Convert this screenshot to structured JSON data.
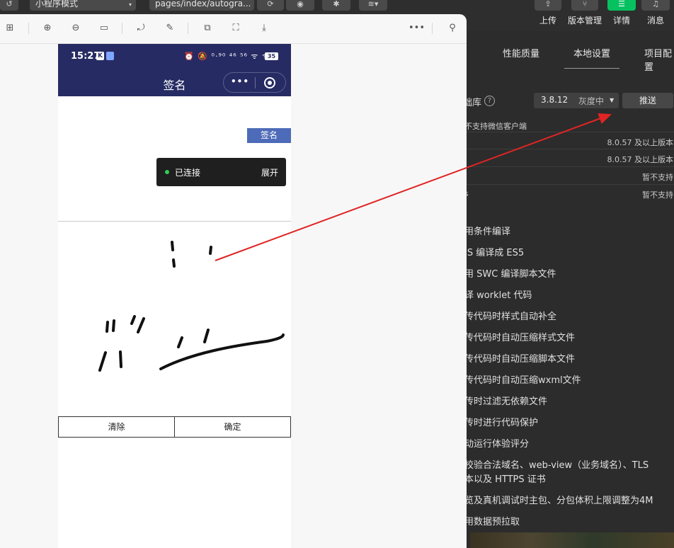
{
  "toolbar": {
    "mode_select": "小程序模式",
    "page_path": "pages/index/autogra...",
    "upload_label": "上传",
    "version_mgmt_label": "版本管理",
    "details_label": "详情",
    "messages_label": "消息"
  },
  "settings_panel": {
    "tabs": [
      "性能质量",
      "本地设置",
      "项目配置"
    ],
    "active_tab": "本地设置",
    "base_lib_label": "础库",
    "base_lib_version": "3.8.12",
    "base_lib_channel": "灰度中",
    "push_label": "推送",
    "support_note": "不支持微信客户端",
    "kv_rows": [
      {
        "key": "",
        "value": "8.0.57 及以上版本"
      },
      {
        "key": "",
        "value": "8.0.57 及以上版本"
      },
      {
        "key": "",
        "value": "暂不支持"
      },
      {
        "key": "s",
        "value": "暂不支持"
      }
    ],
    "options": [
      "用条件编译",
      "JS 编译成 ES5",
      "用 SWC 编译脚本文件",
      "译 worklet 代码",
      "传代码时样式自动补全",
      "传代码时自动压缩样式文件",
      "传代码时自动压缩脚本文件",
      "传代码时自动压缩wxml文件",
      "传时过滤无依赖文件",
      "传时进行代码保护",
      "动运行体验评分",
      "校验合法域名、web-view（业务域名）、TLS",
      "本以及 HTTPS 证书",
      "览及真机调试时主包、分包体积上限调整为4M",
      "用数据预拉取"
    ]
  },
  "phone": {
    "time": "15:27",
    "status_badge_k": "K",
    "status_icons": "⏰ 🔕 ⁰·⁹⁰ ⁴⁶ ⁵⁶ ᯤ ᯤ",
    "battery": "35",
    "nav_title": "签名",
    "capsule_more": "•••",
    "sign_button": "签名",
    "connection_status": "已连接",
    "connection_expand": "展开",
    "clear_button": "清除",
    "confirm_button": "确定"
  },
  "colors": {
    "nav_bg": "#262b63",
    "sign_button": "#4d6bb8",
    "connected_dot": "#2fcf56",
    "arrow": "#e02424",
    "upload_green": "#07c160"
  }
}
